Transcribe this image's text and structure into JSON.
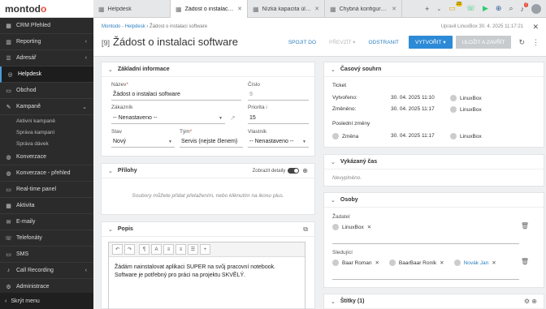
{
  "sidebar": {
    "logo_a": "montod",
    "logo_b": "o",
    "items": [
      {
        "label": "CRM Přehled",
        "icon": "dashboard-icon",
        "glyph": "▦",
        "arrow": ""
      },
      {
        "label": "Reporting",
        "icon": "chart-icon",
        "glyph": "▥",
        "arrow": "‹"
      },
      {
        "label": "Adresář",
        "icon": "contacts-icon",
        "glyph": "☰",
        "arrow": "‹"
      },
      {
        "label": "Helpdesk",
        "icon": "helpdesk-icon",
        "glyph": "◎",
        "arrow": ""
      },
      {
        "label": "Obchod",
        "icon": "deal-icon",
        "glyph": "▭",
        "arrow": ""
      },
      {
        "label": "Kampaně",
        "icon": "campaign-icon",
        "glyph": "✎",
        "arrow": "⌄"
      }
    ],
    "subitems": [
      "Aktivní kampaně",
      "Správa kampaní",
      "Správa dávek"
    ],
    "items2": [
      {
        "label": "Konverzace",
        "icon": "chat-icon",
        "glyph": "◍"
      },
      {
        "label": "Konverzace - přehled",
        "icon": "chat-overview-icon",
        "glyph": "◍"
      },
      {
        "label": "Real-time panel",
        "icon": "monitor-icon",
        "glyph": "▭"
      },
      {
        "label": "Aktivita",
        "icon": "activity-icon",
        "glyph": "▦"
      },
      {
        "label": "E-maily",
        "icon": "email-icon",
        "glyph": "✉"
      },
      {
        "label": "Telefonáty",
        "icon": "phone-icon",
        "glyph": "☏"
      },
      {
        "label": "SMS",
        "icon": "sms-icon",
        "glyph": "▭"
      },
      {
        "label": "Call Recording",
        "icon": "mic-icon",
        "glyph": "♪",
        "arrow": "‹"
      },
      {
        "label": "Administrace",
        "icon": "admin-icon",
        "glyph": "⚙"
      }
    ],
    "hide": "Skrýt menu"
  },
  "tabs": [
    {
      "label": "Helpdesk"
    },
    {
      "label": "Žádost o instalaci ..."
    },
    {
      "label": "Nízká kapacita úloži..."
    },
    {
      "label": "Chybná konfigurace..."
    }
  ],
  "badges": {
    "notif": "22",
    "alerts": "7"
  },
  "header": {
    "crumb_link": "Montodo - Helpdesk",
    "crumb_rest": " › Žádost o instalaci software",
    "updated": "Upravil LinuxBox  30. 4. 2025 11:17:21",
    "num": "[9]",
    "title": "Žádost o instalaci software",
    "spojit": "SPOJIT DO",
    "prevzit": "PŘEVZÍT",
    "odstranit": "ODSTRANIT",
    "vytvorit": "VYTVOŘIT",
    "ulozit": "ULOŽIT A ZAVŘÍT"
  },
  "basic": {
    "title": "Základní informace",
    "nazev_lbl": "Název",
    "nazev": "Žádost o instalaci software",
    "cislo_lbl": "Číslo",
    "cislo": "9",
    "zakaznik_lbl": "Zákazník",
    "zakaznik": "-- Nenastaveno --",
    "priorita_lbl": "Priorita",
    "priorita": "15",
    "stav_lbl": "Stav",
    "stav": "Nový",
    "tym_lbl": "Tým",
    "tym": "Servis (nejste členem)",
    "vlastnik_lbl": "Vlastník",
    "vlastnik": "-- Nenastaveno --"
  },
  "prilohy": {
    "title": "Přílohy",
    "toggle": "Zobrazit detaily",
    "empty": "Soubory můžete přidat přetažením, nebo kliknutím na ikonu plus."
  },
  "popis": {
    "title": "Popis",
    "line1": "Žádám nainstalovat aplikaci SUPER na svůj pracovní notebook.",
    "line2": "Software je potřebný pro práci na projektu SKVĚLÝ."
  },
  "cas": {
    "title": "Časový souhrn",
    "ticket": "Ticket",
    "vytvoreno_lbl": "Vytvořeno:",
    "vytvoreno": "30. 04. 2025 11:10",
    "vytvoreno_user": "LinuxBox",
    "zmeneno_lbl": "Změněno:",
    "zmeneno": "30. 04. 2025 11:17",
    "zmeneno_user": "LinuxBox",
    "posledni": "Poslední změny",
    "zmena_lbl": "Změna",
    "zmena": "30. 04. 2025 11:17",
    "zmena_user": "LinuxBox"
  },
  "vykazany": {
    "title": "Vykázaný čas",
    "empty": "Nevyplněno."
  },
  "osoby": {
    "title": "Osoby",
    "zadatel_lbl": "Žadatel",
    "zadatel": "LinuxBox",
    "sledujici_lbl": "Sledující",
    "s1": "Baar Roman",
    "s2": "BaarBaar Roník",
    "s3": "Novák Jan"
  },
  "stitky": {
    "title": "Štítky (1)"
  }
}
